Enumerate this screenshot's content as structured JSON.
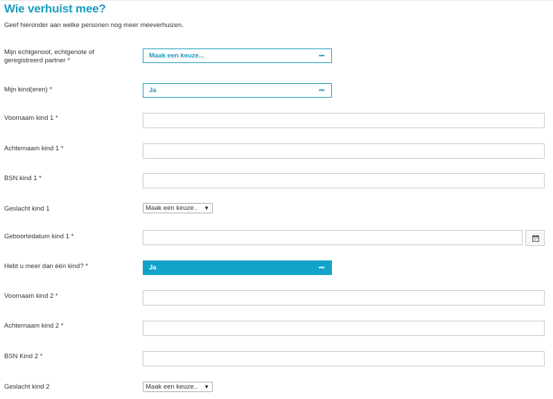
{
  "page": {
    "title": "Wie verhuist mee?",
    "intro": "Geef hieronder aan welke personen nog meer meeverhuizen."
  },
  "fields": {
    "partner": {
      "label": "Mijn echtgenoot, echtgenote of geregistreerd partner *",
      "value": "Maak een keuze...",
      "dots": "•••"
    },
    "kinderen": {
      "label": "Mijn kind(eren) *",
      "value": "Ja",
      "dots": "•••"
    },
    "voornaam_kind_1": {
      "label": "Voornaam kind 1 *",
      "value": ""
    },
    "achternaam_kind_1": {
      "label": "Achternaam kind 1 *",
      "value": ""
    },
    "bsn_kind_1": {
      "label": "BSN kind 1 *",
      "value": ""
    },
    "geslacht_kind_1": {
      "label": "Geslacht kind 1",
      "value": "Maak een keuze.."
    },
    "geboortedatum_kind_1": {
      "label": "Geboortedatum kind 1 *",
      "value": "",
      "icon": "calendar-icon"
    },
    "meer_dan_een_kind": {
      "label": "Hebt u meer dan één kind? *",
      "value": "Ja",
      "dots": "•••"
    },
    "voornaam_kind_2": {
      "label": "Voornaam kind 2 *",
      "value": ""
    },
    "achternaam_kind_2": {
      "label": "Achternaam kind 2 *",
      "value": ""
    },
    "bsn_kind_2": {
      "label": "BSN Kind 2 *",
      "value": ""
    },
    "geslacht_kind_2": {
      "label": "Geslacht kind 2",
      "value": "Maak een keuze.."
    }
  },
  "colors": {
    "accent": "#1a9bbf",
    "accent_active": "#13a3c9",
    "border": "#c9c9c9"
  }
}
